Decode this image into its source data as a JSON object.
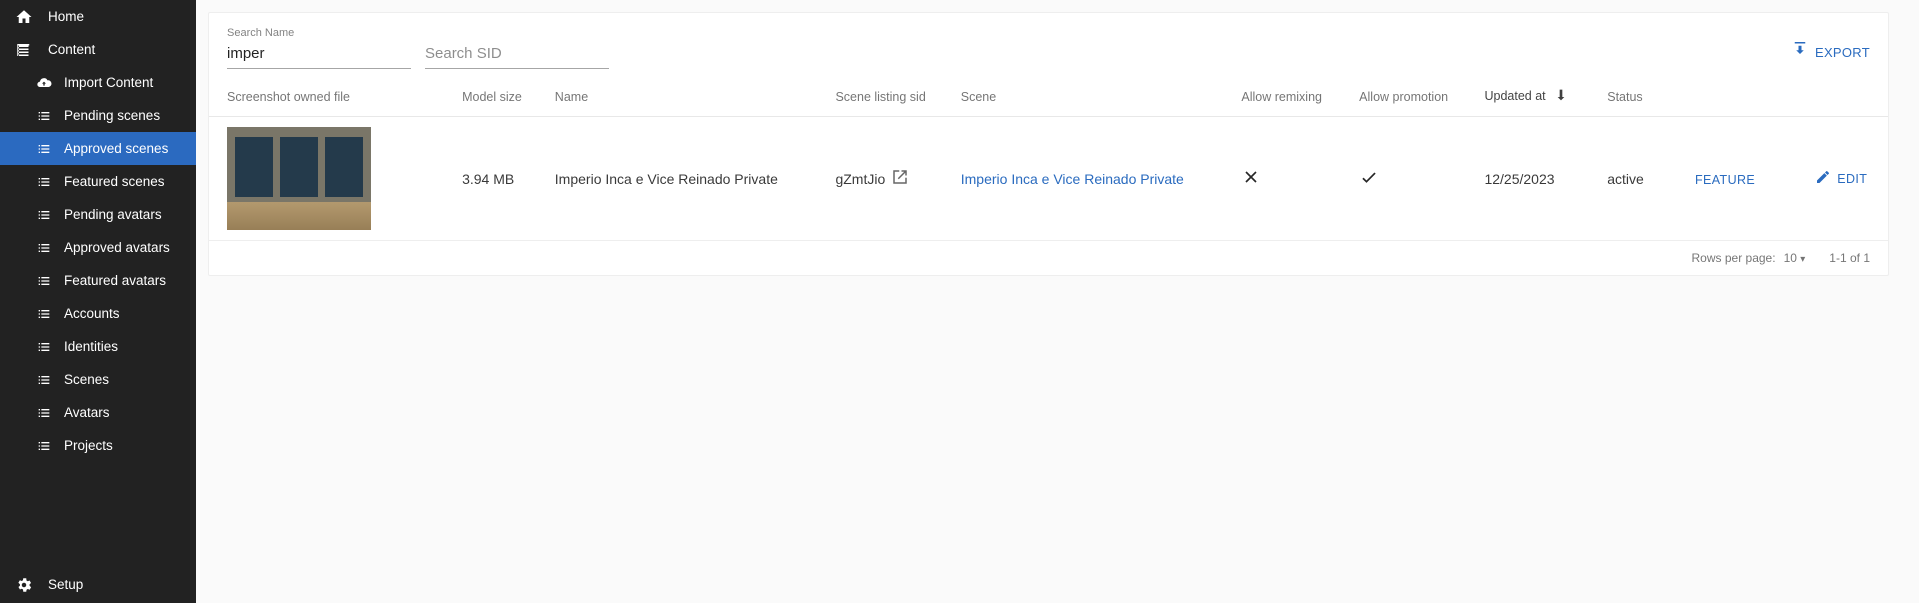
{
  "sidebar": {
    "home": "Home",
    "content": "Content",
    "setup": "Setup",
    "items": [
      {
        "label": "Import Content"
      },
      {
        "label": "Pending scenes"
      },
      {
        "label": "Approved scenes"
      },
      {
        "label": "Featured scenes"
      },
      {
        "label": "Pending avatars"
      },
      {
        "label": "Approved avatars"
      },
      {
        "label": "Featured avatars"
      },
      {
        "label": "Accounts"
      },
      {
        "label": "Identities"
      },
      {
        "label": "Scenes"
      },
      {
        "label": "Avatars"
      },
      {
        "label": "Projects"
      }
    ]
  },
  "toolbar": {
    "search_name_label": "Search Name",
    "search_name_value": "imper",
    "search_sid_placeholder": "Search SID",
    "export_label": "EXPORT"
  },
  "columns": {
    "screenshot": "Screenshot owned file",
    "model_size": "Model size",
    "name": "Name",
    "scene_listing_sid": "Scene listing sid",
    "scene": "Scene",
    "allow_remixing": "Allow remixing",
    "allow_promotion": "Allow promotion",
    "updated_at": "Updated at",
    "status": "Status"
  },
  "rows": [
    {
      "model_size": "3.94 MB",
      "name": "Imperio Inca e Vice Reinado Private",
      "sid": "gZmtJio",
      "scene": "Imperio Inca e Vice Reinado Private",
      "allow_remixing": false,
      "allow_promotion": true,
      "updated_at": "12/25/2023",
      "status": "active"
    }
  ],
  "actions": {
    "feature": "FEATURE",
    "edit": "EDIT"
  },
  "pagination": {
    "rows_per_page_label": "Rows per page:",
    "rows_per_page_value": "10",
    "range": "1-1 of 1"
  }
}
